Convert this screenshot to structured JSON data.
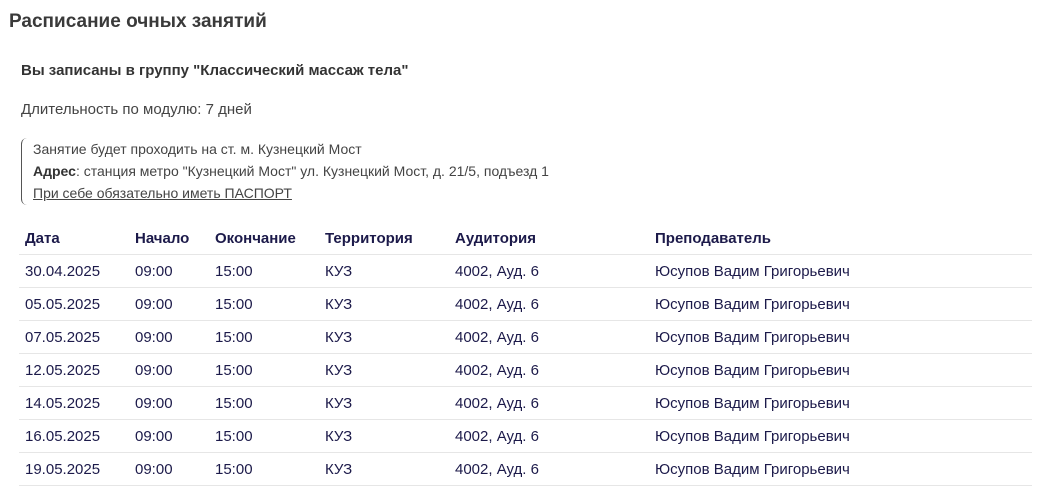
{
  "page": {
    "title": "Расписание очных занятий"
  },
  "group": {
    "text": "Вы записаны в группу \"Классический массаж тела\""
  },
  "duration": {
    "text": "Длительность по модулю: 7 дней"
  },
  "notice": {
    "line1": "Занятие будет проходить на ст. м. Кузнецкий Мост",
    "address_label": "Адрес",
    "address_value": ": станция метро \"Кузнецкий Мост\" ул. Кузнецкий Мост, д. 21/5, подъезд 1",
    "passport_link": "При себе обязательно иметь ПАСПОРТ"
  },
  "table": {
    "headers": [
      "Дата",
      "Начало",
      "Окончание",
      "Территория",
      "Аудитория",
      "Преподаватель"
    ],
    "rows": [
      [
        "30.04.2025",
        "09:00",
        "15:00",
        "КУЗ",
        "4002, Ауд. 6",
        "Юсупов Вадим Григорьевич"
      ],
      [
        "05.05.2025",
        "09:00",
        "15:00",
        "КУЗ",
        "4002, Ауд. 6",
        "Юсупов Вадим Григорьевич"
      ],
      [
        "07.05.2025",
        "09:00",
        "15:00",
        "КУЗ",
        "4002, Ауд. 6",
        "Юсупов Вадим Григорьевич"
      ],
      [
        "12.05.2025",
        "09:00",
        "15:00",
        "КУЗ",
        "4002, Ауд. 6",
        "Юсупов Вадим Григорьевич"
      ],
      [
        "14.05.2025",
        "09:00",
        "15:00",
        "КУЗ",
        "4002, Ауд. 6",
        "Юсупов Вадим Григорьевич"
      ],
      [
        "16.05.2025",
        "09:00",
        "15:00",
        "КУЗ",
        "4002, Ауд. 6",
        "Юсупов Вадим Григорьевич"
      ],
      [
        "19.05.2025",
        "09:00",
        "15:00",
        "КУЗ",
        "4002, Ауд. 6",
        "Юсупов Вадим Григорьевич"
      ]
    ]
  },
  "colors": {
    "title": "#3a3a3a",
    "table_text": "#1c1a4a",
    "divider": "#e6e6e6"
  }
}
